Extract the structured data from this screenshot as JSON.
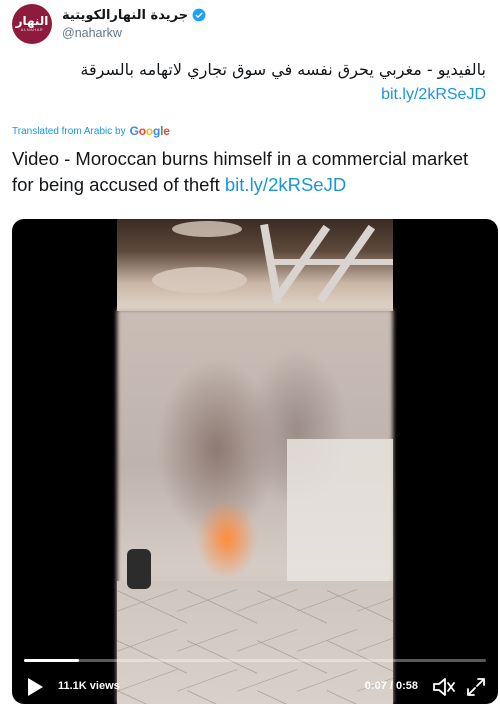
{
  "header": {
    "display_name": "جريدة النهارالكويتية",
    "handle": "@naharkw",
    "avatar": {
      "logo_text": "النهار",
      "logo_sub": "ALNAHAR"
    }
  },
  "tweet": {
    "arabic_text": "بالفيديو - مغربي يحرق نفسه في سوق تجاري لاتهامه بالسرقة",
    "arabic_link": "bit.ly/2kRSeJD",
    "translated_label": "Translated from Arabic by",
    "google_letters": [
      "G",
      "o",
      "o",
      "g",
      "l",
      "e"
    ],
    "translated_text": "Video - Moroccan burns himself in a commercial market for being accused of theft",
    "translated_link": "bit.ly/2kRSeJD"
  },
  "video": {
    "views": "11.1K views",
    "time": "0:07 / 0:58",
    "progress": 0.12,
    "icons": {
      "play": "play-icon",
      "volume": "volume-icon",
      "fullscreen": "fullscreen-icon",
      "verified": "verified-badge-icon"
    }
  },
  "colors": {
    "link": "#1b95e0",
    "avatar": "#8e1a3e",
    "video_bg": "#000000"
  }
}
